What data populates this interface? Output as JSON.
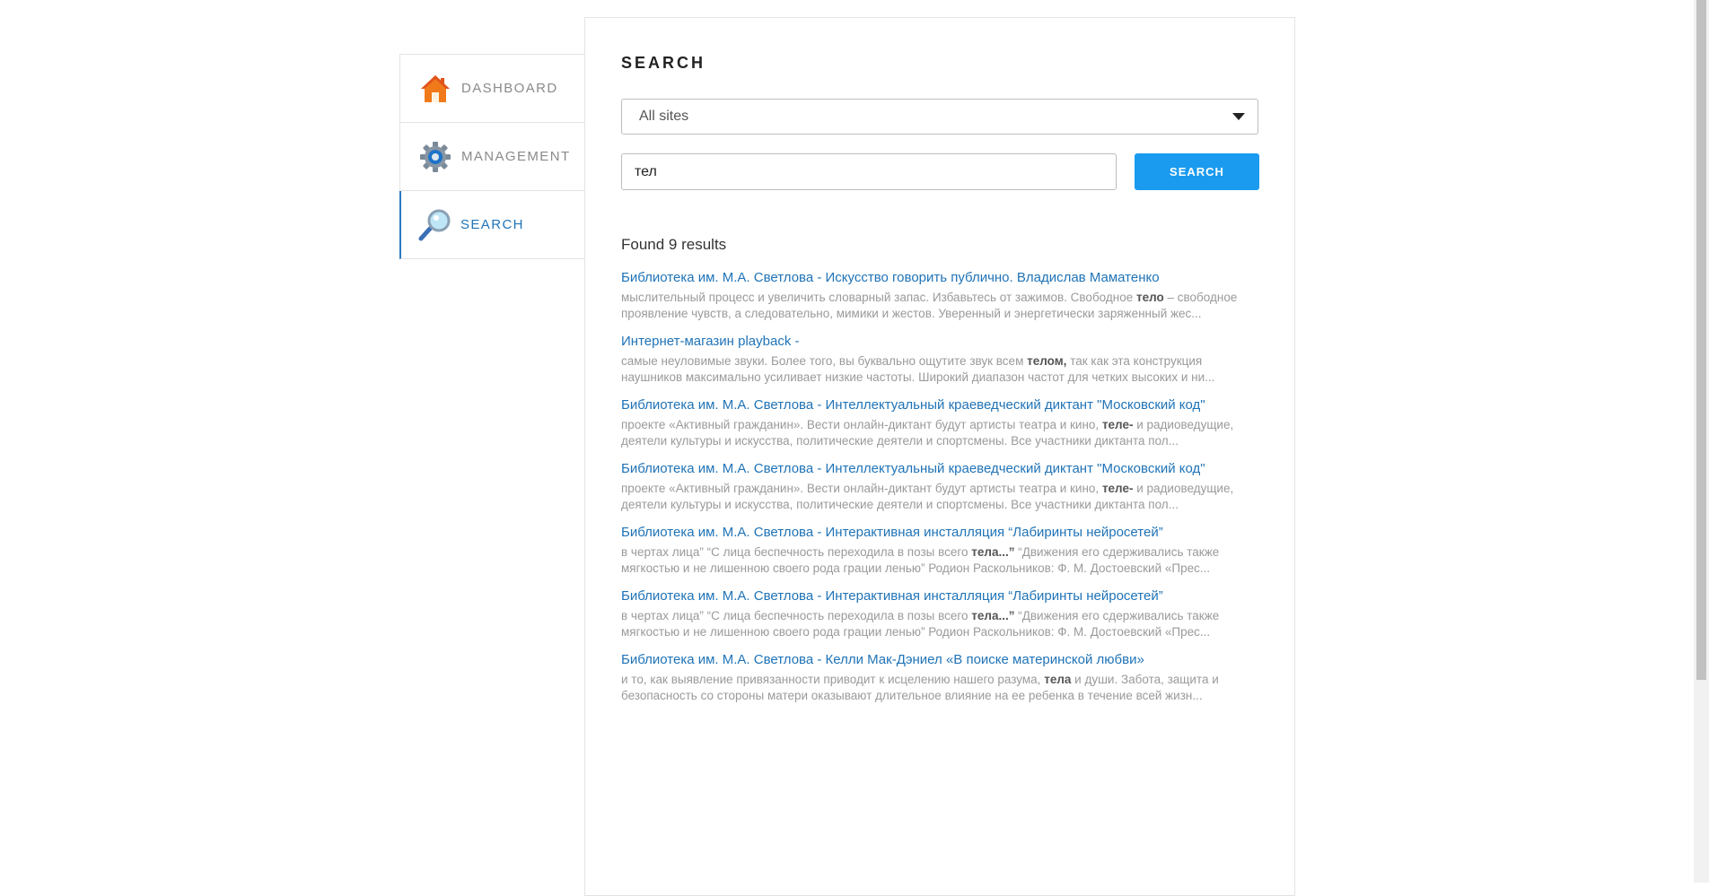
{
  "sidebar": {
    "items": [
      {
        "label": "DASHBOARD",
        "icon": "home-icon"
      },
      {
        "label": "MANAGEMENT",
        "icon": "gear-icon"
      },
      {
        "label": "SEARCH",
        "icon": "magnifier-icon",
        "active": true
      }
    ]
  },
  "main": {
    "title": "SEARCH",
    "site_select": {
      "selected": "All sites"
    },
    "query": {
      "value": "тел"
    },
    "search_button": "SEARCH",
    "found_text": "Found 9 results"
  },
  "results": [
    {
      "title": "Библиотека им. М.А. Светлова - Искусство говорить публично. Владислав Маматенко",
      "pre": "мыслительный процесс и увеличить словарный запас. Избавьтесь от зажимов. Свободное ",
      "hl": "тело",
      "post": " – свободное проявление чувств, а следовательно, мимики и жестов. Уверенный и энергетически заряженный жес..."
    },
    {
      "title": "Интернет-магазин playback -",
      "pre": "самые неуловимые звуки. Более того, вы буквально ощутите звук всем ",
      "hl": "телом,",
      "post": " так как эта конструкция наушников максимально усиливает низкие частоты. Широкий диапазон частот для четких высоких и ни..."
    },
    {
      "title": "Библиотека им. М.А. Светлова - Интеллектуальный краеведческий диктант \"Московский код\"",
      "pre": "проекте «Активный гражданин». Вести онлайн-диктант будут артисты театра и кино, ",
      "hl": "теле-",
      "post": " и радиоведущие, деятели культуры и искусства, политические деятели и спортсмены. Все участники диктанта пол..."
    },
    {
      "title": "Библиотека им. М.А. Светлова - Интеллектуальный краеведческий диктант \"Московский код\"",
      "pre": "проекте «Активный гражданин». Вести онлайн-диктант будут артисты театра и кино, ",
      "hl": "теле-",
      "post": " и радиоведущие, деятели культуры и искусства, политические деятели и спортсмены. Все участники диктанта пол..."
    },
    {
      "title": "Библиотека им. М.А. Светлова - Интерактивная инсталляция “Лабиринты нейросетей”",
      "pre": "в чертах лица” “С лица беспечность переходила в позы всего ",
      "hl": "тела...”",
      "post": " “Движения его сдерживались также мягкостью и не лишенною своего рода грации ленью” Родион Раскольников: Ф. М. Достоевский «Прес..."
    },
    {
      "title": "Библиотека им. М.А. Светлова - Интерактивная инсталляция “Лабиринты нейросетей”",
      "pre": "в чертах лица” “С лица беспечность переходила в позы всего ",
      "hl": "тела...”",
      "post": " “Движения его сдерживались также мягкостью и не лишенною своего рода грации ленью” Родион Раскольников: Ф. М. Достоевский «Прес..."
    },
    {
      "title": "Библиотека им. М.А. Светлова - Келли Мак-Дэниел «В поиске материнской любви»",
      "pre": "и то, как выявление привязанности приводит к исцелению нашего разума, ",
      "hl": "тела",
      "post": " и души. Забота, защита и безопасность со стороны матери оказывают длительное влияние на ее ребенка в течение всей жизн..."
    }
  ]
}
